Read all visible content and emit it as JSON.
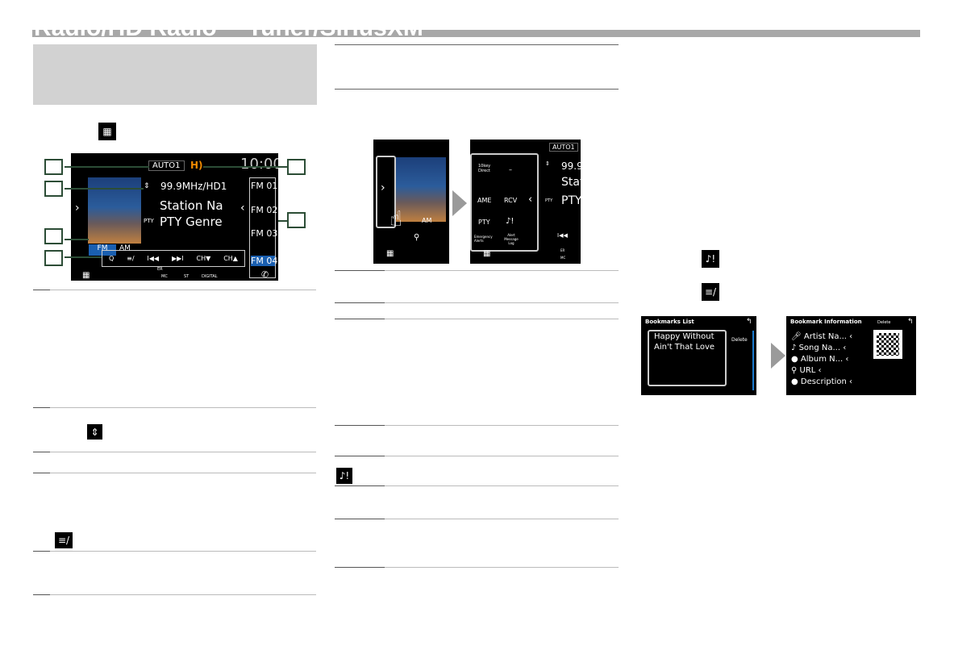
{
  "header": {
    "title": "Radio/HD Radio™ Tuner/SiriusXM"
  },
  "main_screen": {
    "preset": "AUTO1",
    "hd_icon": "hd-radio-icon",
    "time": "10:00",
    "frequency": "99.9MHz/HD1",
    "station": "Station Na",
    "pty_label": "PTY",
    "pty": "PTY Genre",
    "bands": [
      "FM",
      "AM"
    ],
    "presets": [
      "FM 01",
      "FM 02",
      "FM 03",
      "FM 04"
    ],
    "controls": [
      "Q",
      "≡/",
      "I◀◀",
      "▶▶I",
      "CH▼",
      "CH▲"
    ],
    "status": {
      "er": "ER",
      "mc": "MC",
      "st": "ST",
      "digital": "DIGITAL"
    }
  },
  "popup_screen": {
    "preset": "AUTO1",
    "frequency": "99.9",
    "station": "Stat",
    "pty_label": "PTY",
    "pty": "PTY",
    "buttons": [
      "10key Direct",
      "–",
      "AME",
      "RCV",
      "PTY",
      "Emergency Alerts",
      "Alert Message Log"
    ],
    "band": "AM",
    "status": {
      "er": "ER",
      "mc": "MC"
    }
  },
  "bookmarks_list": {
    "title": "Bookmarks List",
    "items": [
      "Happy Without",
      "Ain't That Love"
    ],
    "delete": "Delete"
  },
  "bookmark_info": {
    "title": "Bookmark Information",
    "delete": "Delete",
    "fields": [
      "Artist Na...",
      "Song Na...",
      "Album N...",
      "URL",
      "Description"
    ]
  },
  "colors": {
    "accent": "#1a7bd0",
    "callout": "#2c4d36",
    "hd": "#f08a00"
  }
}
